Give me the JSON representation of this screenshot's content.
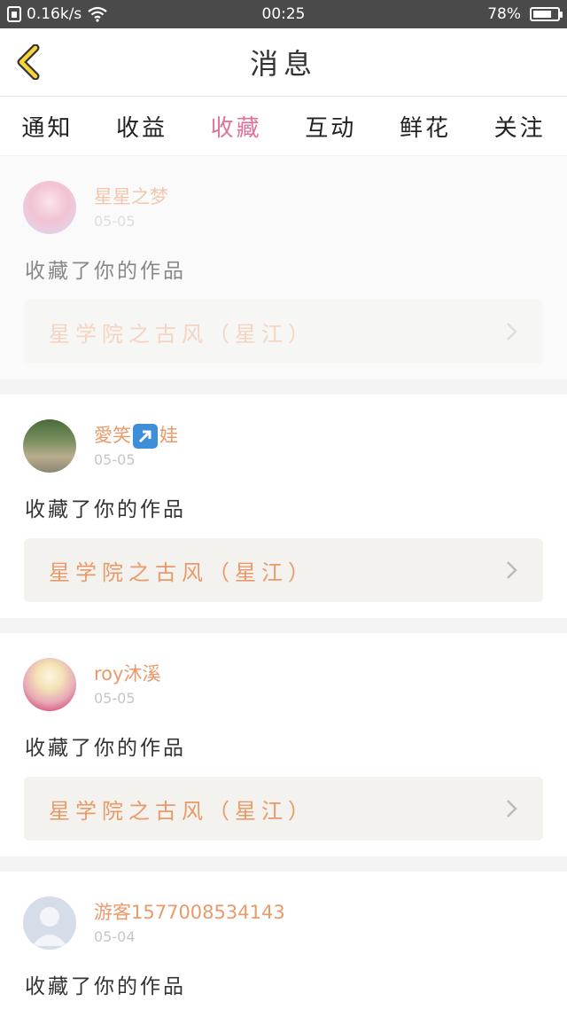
{
  "status_bar": {
    "speed": "0.16k/s",
    "time": "00:25",
    "battery": "78%",
    "battery_level": 0.78
  },
  "header": {
    "title": "消息"
  },
  "tabs": [
    {
      "label": "通知",
      "active": false
    },
    {
      "label": "收益",
      "active": false
    },
    {
      "label": "收藏",
      "active": true
    },
    {
      "label": "互动",
      "active": false
    },
    {
      "label": "鲜花",
      "active": false
    },
    {
      "label": "关注",
      "active": false
    }
  ],
  "messages": [
    {
      "user": "星星之梦",
      "date": "05-05",
      "action": "收藏了你的作品",
      "work": "星学院之古风（星江）"
    },
    {
      "user_prefix": "愛笑",
      "user_emoji": "arrow-up-right-emoji",
      "user_suffix": "娃",
      "date": "05-05",
      "action": "收藏了你的作品",
      "work": "星学院之古风（星江）"
    },
    {
      "user": "roy沐溪",
      "date": "05-05",
      "action": "收藏了你的作品",
      "work": "星学院之古风（星江）"
    },
    {
      "user": "游客1577008534143",
      "date": "05-04",
      "action": "收藏了你的作品"
    }
  ],
  "colors": {
    "accent": "#e0739b",
    "username": "#e89a6a",
    "work_bg": "#f3f2ee"
  }
}
